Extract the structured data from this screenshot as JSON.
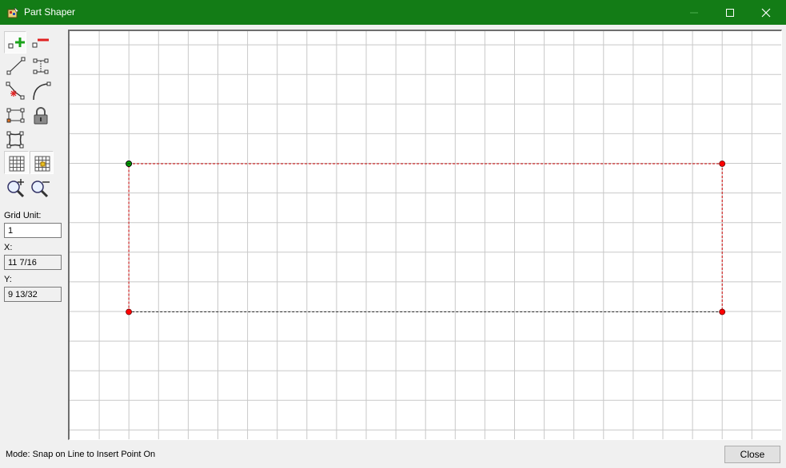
{
  "window": {
    "title": "Part Shaper",
    "title_bar_color": "#137c16"
  },
  "toolbar": {
    "tools": [
      {
        "name": "add-point-tool",
        "icon": "plus-green-icon",
        "pressed": true
      },
      {
        "name": "remove-point-tool",
        "icon": "minus-red-icon",
        "pressed": false
      },
      {
        "name": "line-tool",
        "icon": "diagonal-line-icon",
        "pressed": false
      },
      {
        "name": "measure-tool",
        "icon": "dimension-icon",
        "pressed": false
      },
      {
        "name": "delete-segment-tool",
        "icon": "segment-delete-icon",
        "pressed": false
      },
      {
        "name": "arc-tool",
        "icon": "arc-icon",
        "pressed": false
      },
      {
        "name": "rectangle-tool",
        "icon": "rectangle-icon",
        "pressed": false
      },
      {
        "name": "lock-tool",
        "icon": "lock-icon",
        "pressed": false
      },
      {
        "name": "shape-tool",
        "icon": "concave-rectangle-icon",
        "pressed": false
      },
      {
        "name": "grid-tool",
        "icon": "grid-icon",
        "pressed": true
      },
      {
        "name": "snap-grid-tool",
        "icon": "snap-grid-icon",
        "pressed": true
      },
      {
        "name": "zoom-in-tool",
        "icon": "zoom-in-icon",
        "pressed": false
      },
      {
        "name": "zoom-out-tool",
        "icon": "zoom-out-icon",
        "pressed": false
      }
    ]
  },
  "fields": {
    "grid_unit_label": "Grid Unit:",
    "grid_unit_value": "1",
    "x_label": "X:",
    "x_value": "11 7/16",
    "y_label": "Y:",
    "y_value": "9 13/32"
  },
  "canvas": {
    "shape_points": [
      {
        "id": "start-point",
        "color": "#00aa00"
      },
      {
        "id": "point",
        "color": "#ff0000"
      },
      {
        "id": "point",
        "color": "#ff0000"
      },
      {
        "id": "point",
        "color": "#ff0000"
      }
    ],
    "edge_color": "#cc0000",
    "bottom_edge_color": "#333333",
    "grid_color": "#c8c8c8"
  },
  "status": {
    "mode_text": "Mode: Snap on Line to Insert Point On"
  },
  "buttons": {
    "close_label": "Close"
  }
}
